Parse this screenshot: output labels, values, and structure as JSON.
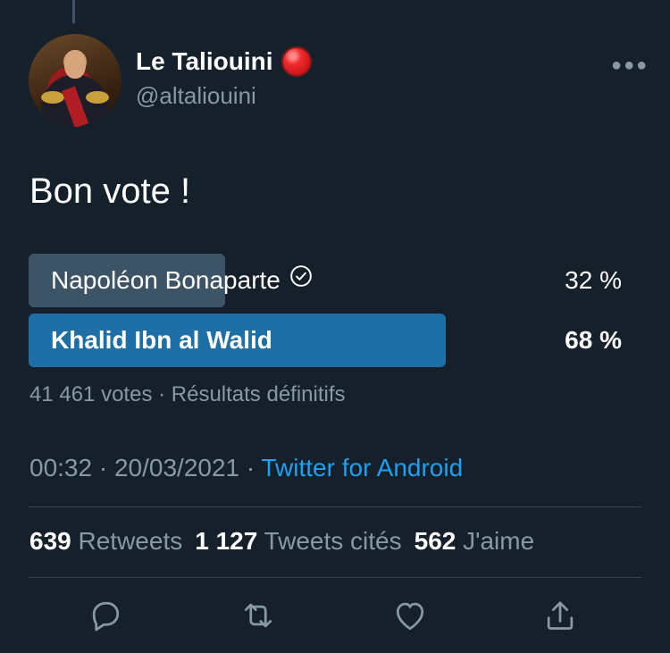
{
  "author": {
    "display_name": "Le Taliouini",
    "handle": "@altaliouini"
  },
  "tweet": {
    "text": "Bon vote !"
  },
  "poll": {
    "options": [
      {
        "label": "Napoléon Bonaparte",
        "percent_text": "32 %",
        "percent": 32,
        "winner": false
      },
      {
        "label": "Khalid Ibn al Walid",
        "percent_text": "68 %",
        "percent": 68,
        "winner": true
      }
    ],
    "meta": "41 461 votes · Résultats définitifs"
  },
  "timestamp": {
    "time": "00:32",
    "sep1": " · ",
    "date": "20/03/2021",
    "sep2": " · ",
    "source": "Twitter for Android"
  },
  "stats": {
    "retweets_count": "639",
    "retweets_label": "Retweets",
    "quotes_count": "1 127",
    "quotes_label": "Tweets cités",
    "likes_count": "562",
    "likes_label": "J'aime"
  },
  "icons": {
    "more": "more-horizontal-icon",
    "reply": "reply-icon",
    "retweet": "retweet-icon",
    "like": "heart-icon",
    "share": "share-icon"
  },
  "colors": {
    "background": "#15202b",
    "accent": "#1da1f2",
    "poll_winner": "#1d6fa5",
    "poll_loser": "#3d5466",
    "muted": "#8899a6"
  }
}
